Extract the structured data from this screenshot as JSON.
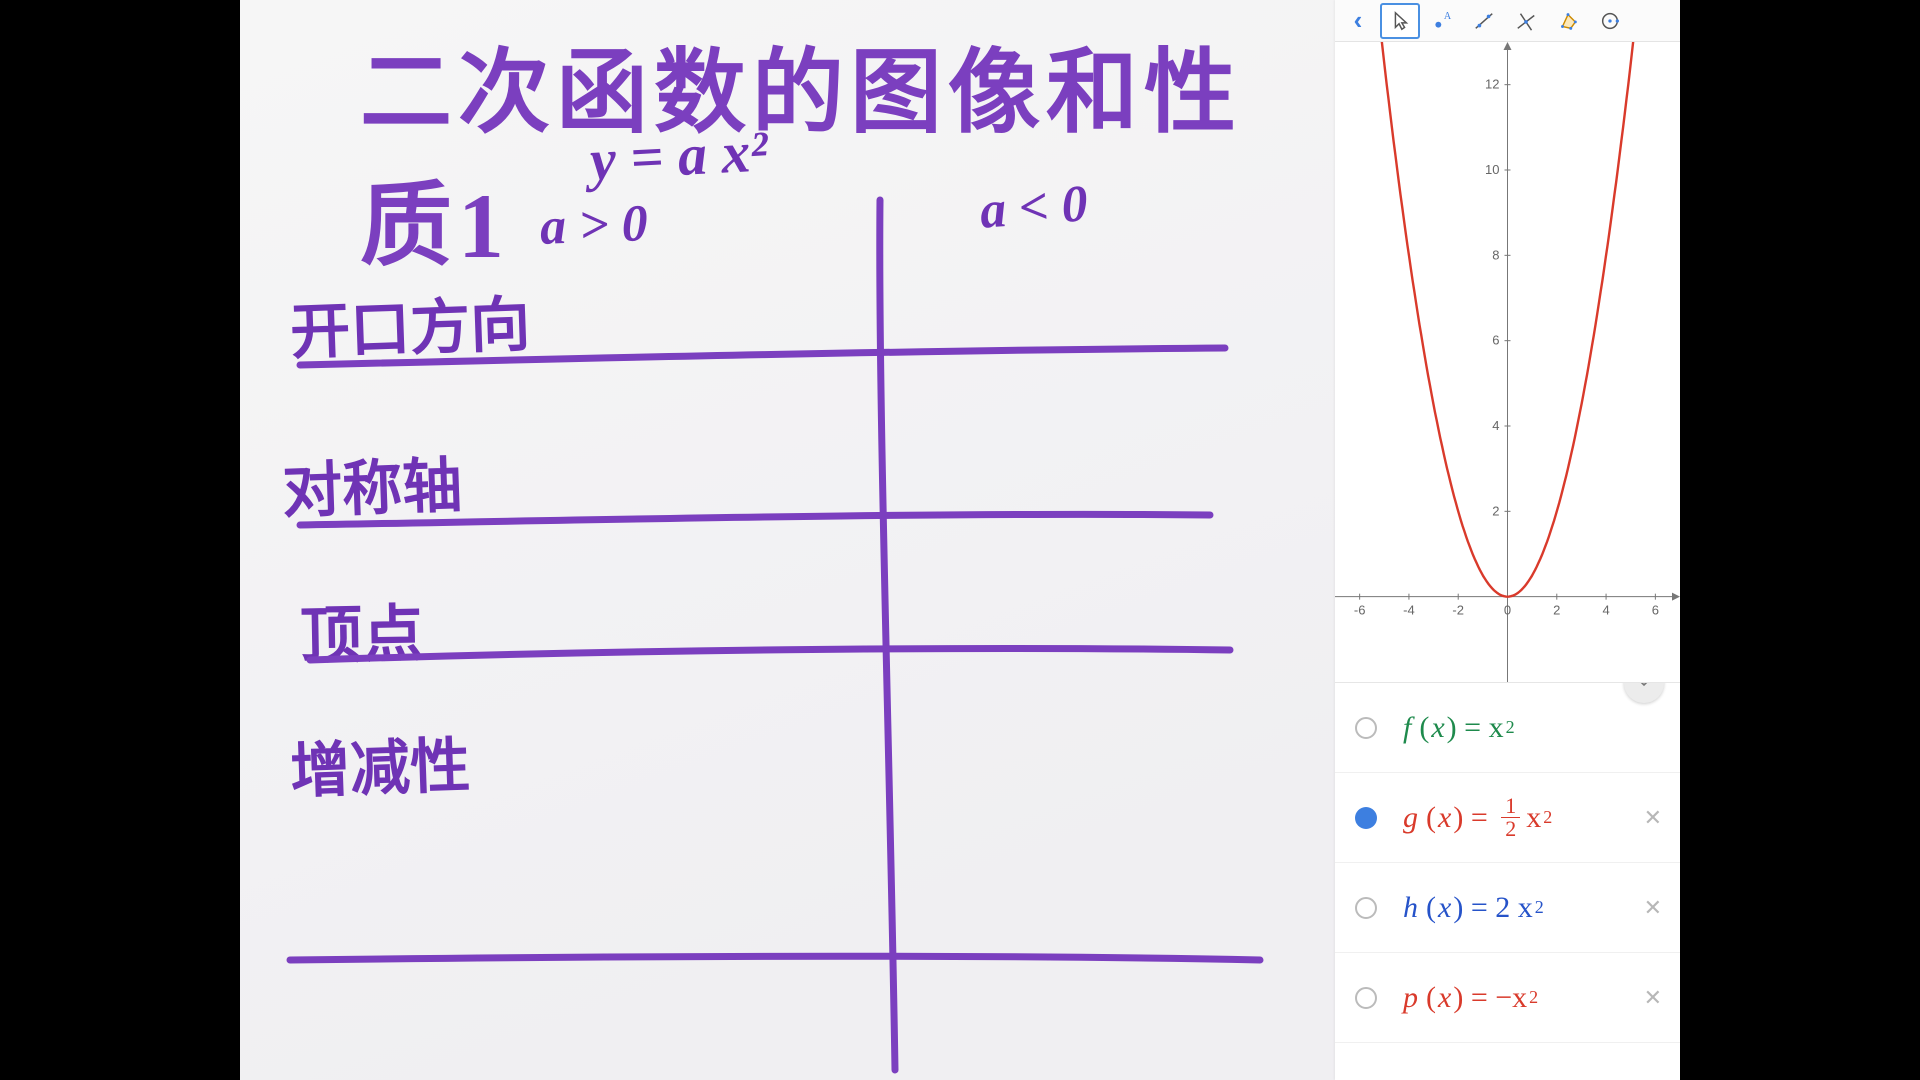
{
  "whiteboard": {
    "title": "二次函数的图像和性质1",
    "equation": "y = a x²",
    "col_a_pos": "a > 0",
    "col_a_neg": "a < 0",
    "rows": [
      "开口方向",
      "对称轴",
      "顶点",
      "增减性"
    ]
  },
  "toolbar": {
    "back": "‹",
    "tools": [
      "move",
      "point",
      "line",
      "perpendicular",
      "polygon",
      "circle"
    ]
  },
  "chart_data": {
    "type": "line",
    "title": "",
    "xlabel": "",
    "ylabel": "",
    "xlim": [
      -7,
      7
    ],
    "ylim": [
      -2,
      13
    ],
    "xticks": [
      -6,
      -4,
      -2,
      0,
      2,
      4,
      6
    ],
    "yticks": [
      0,
      2,
      4,
      6,
      8,
      10,
      12
    ],
    "series": [
      {
        "name": "g(x) = ½ x²",
        "color": "#d93a2b",
        "x": [
          -5,
          -4,
          -3,
          -2,
          -1,
          0,
          1,
          2,
          3,
          4,
          5
        ],
        "y": [
          12.5,
          8,
          4.5,
          2,
          0.5,
          0,
          0.5,
          2,
          4.5,
          8,
          12.5
        ]
      }
    ]
  },
  "algebra": [
    {
      "id": "f",
      "name": "f",
      "arg": "x",
      "rhs_html": "x<sup>2</sup>",
      "color": "#1e8a4c",
      "selected": false,
      "closable": false
    },
    {
      "id": "g",
      "name": "g",
      "arg": "x",
      "rhs_html": "<span class='frac'><span class='num'>1</span><span class='den'>2</span></span> x<sup>2</sup>",
      "color": "#d93a2b",
      "selected": true,
      "closable": true
    },
    {
      "id": "h",
      "name": "h",
      "arg": "x",
      "rhs_html": "2 x<sup>2</sup>",
      "color": "#2653c9",
      "selected": false,
      "closable": true
    },
    {
      "id": "p",
      "name": "p",
      "arg": "x",
      "rhs_html": "−x<sup>2</sup>",
      "color": "#d93a2b",
      "selected": false,
      "closable": true
    }
  ],
  "algebra_peek": "1"
}
